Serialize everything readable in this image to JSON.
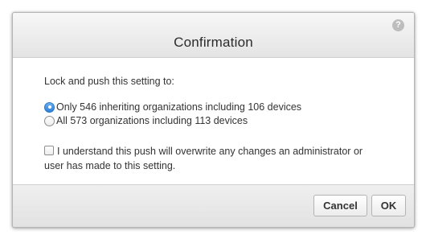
{
  "dialog": {
    "title": "Confirmation",
    "help_glyph": "?",
    "help_icon": "question-mark-circle-icon",
    "prompt": "Lock and push this setting to:",
    "options": [
      {
        "label": "Only 546 inheriting organizations including 106 devices",
        "selected": true
      },
      {
        "label": "All 573 organizations including 113 devices",
        "selected": false
      }
    ],
    "acknowledgement": {
      "label": "I understand this push will overwrite any changes an administrator or user has made to this setting.",
      "checked": false
    },
    "buttons": {
      "cancel": "Cancel",
      "ok": "OK"
    },
    "colors": {
      "radio_selected": "#2b7fd7",
      "help_icon_bg": "#bdbdbd"
    }
  }
}
